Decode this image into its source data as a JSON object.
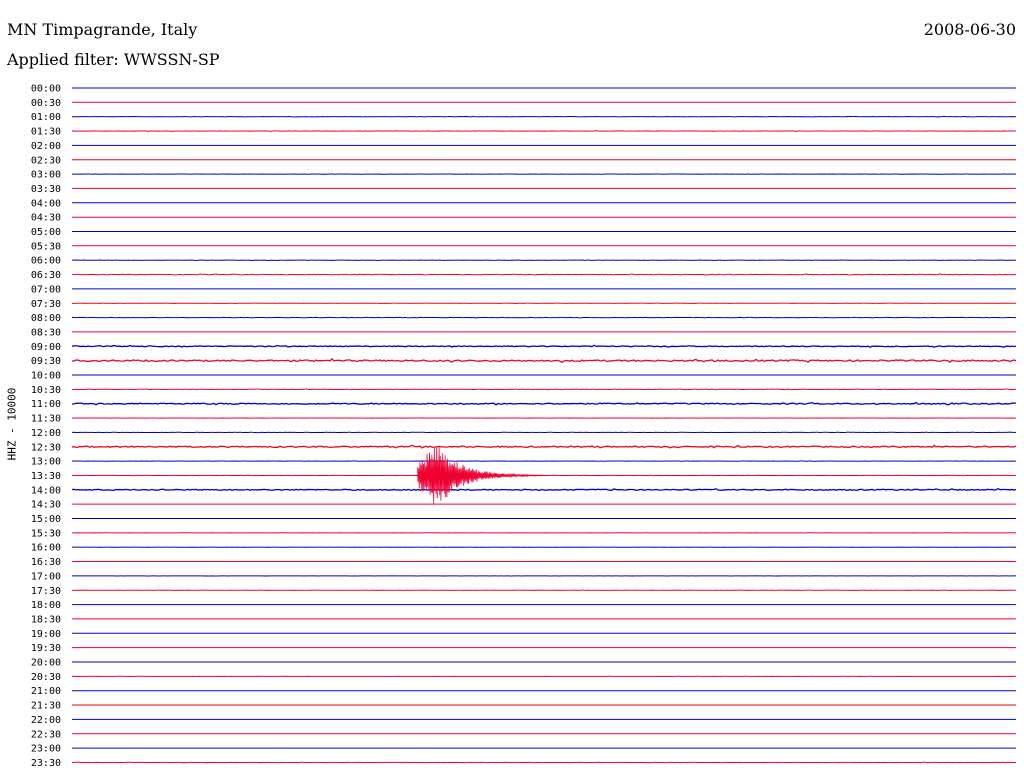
{
  "header": {
    "station": "MN Timpagrande, Italy",
    "date": "2008-06-30",
    "filter": "Applied filter: WWSSN-SP"
  },
  "channel_label": "HHZ - 10000",
  "colors": {
    "even_trace": "#0000cc",
    "odd_trace": "#ee0033",
    "background": "#ffffff"
  },
  "chart_data": {
    "type": "line",
    "subtype": "helicorder",
    "title": "",
    "ylabel": "HHZ - 10000",
    "xlabel": "",
    "row_duration_minutes": 30,
    "time_labels": [
      "00:00",
      "00:30",
      "01:00",
      "01:30",
      "02:00",
      "02:30",
      "03:00",
      "03:30",
      "04:00",
      "04:30",
      "05:00",
      "05:30",
      "06:00",
      "06:30",
      "07:00",
      "07:30",
      "08:00",
      "08:30",
      "09:00",
      "09:30",
      "10:00",
      "10:30",
      "11:00",
      "11:30",
      "12:00",
      "12:30",
      "13:00",
      "13:30",
      "14:00",
      "14:30",
      "15:00",
      "15:30",
      "16:00",
      "16:30",
      "17:00",
      "17:30",
      "18:00",
      "18:30",
      "19:00",
      "19:30",
      "20:00",
      "20:30",
      "21:00",
      "21:30",
      "22:00",
      "22:30",
      "23:00",
      "23:30"
    ],
    "noise_levels": [
      0,
      0,
      0.3,
      0.3,
      0,
      0,
      0.2,
      0,
      0,
      0,
      0,
      0,
      0.3,
      0.6,
      0,
      0.2,
      0.4,
      0,
      0.9,
      1.4,
      0,
      0.4,
      1.1,
      0.2,
      0.3,
      1.2,
      0.2,
      0.3,
      1.0,
      0,
      0,
      0.1,
      0.1,
      0,
      0.1,
      0.2,
      0,
      0,
      0,
      0,
      0,
      0.1,
      0,
      0,
      0,
      0,
      0,
      0.3
    ],
    "events": [
      {
        "row_label": "13:30",
        "start_fraction": 0.366,
        "peak_fraction": 0.387,
        "end_fraction": 0.5,
        "peak_amplitude_rows": 2.3,
        "label": ""
      }
    ]
  }
}
